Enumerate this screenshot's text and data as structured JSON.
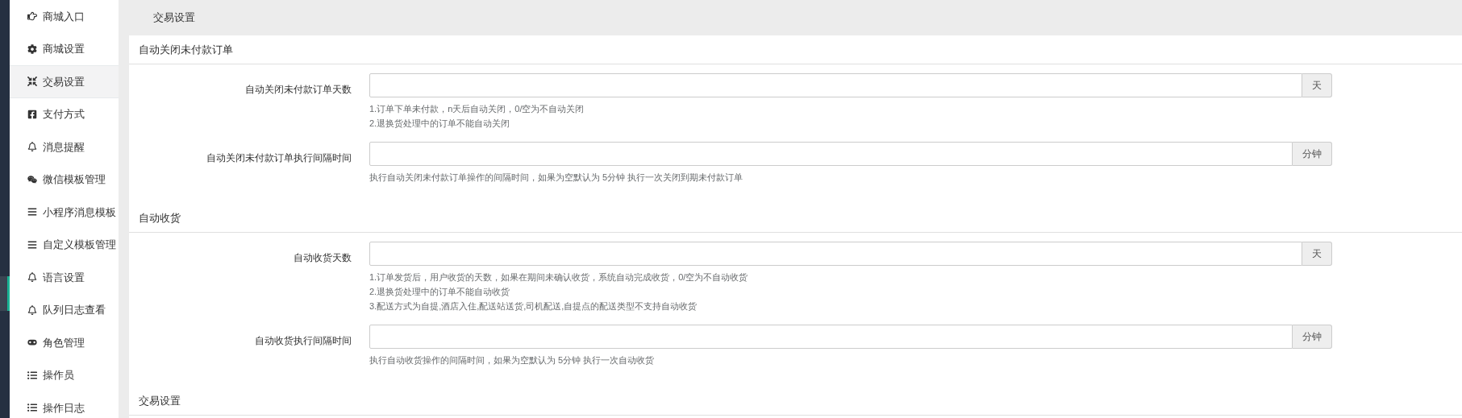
{
  "sidebar": {
    "items": [
      {
        "label": "商城入口",
        "selected": false
      },
      {
        "label": "商城设置",
        "selected": false
      },
      {
        "label": "交易设置",
        "selected": true
      },
      {
        "label": "支付方式",
        "selected": false
      },
      {
        "label": "消息提醒",
        "selected": false
      },
      {
        "label": "微信模板管理",
        "selected": false
      },
      {
        "label": "小程序消息模板",
        "selected": false
      },
      {
        "label": "自定义模板管理",
        "selected": false
      },
      {
        "label": "语言设置",
        "selected": false
      },
      {
        "label": "队列日志查看",
        "selected": false
      },
      {
        "label": "角色管理",
        "selected": false
      },
      {
        "label": "操作员",
        "selected": false
      },
      {
        "label": "操作日志",
        "selected": false
      }
    ]
  },
  "page_title": "交易设置",
  "sections": [
    {
      "title": "自动关闭未付款订单",
      "fields": [
        {
          "label": "自动关闭未付款订单天数",
          "addon": "天",
          "help": [
            "1.订单下单未付款，n天后自动关闭，0/空为不自动关闭",
            "2.退换货处理中的订单不能自动关闭"
          ]
        },
        {
          "label": "自动关闭未付款订单执行间隔时间",
          "addon": "分钟",
          "help": [
            "执行自动关闭未付款订单操作的间隔时间，如果为空默认为 5分钟 执行一次关闭到期未付款订单"
          ]
        }
      ]
    },
    {
      "title": "自动收货",
      "fields": [
        {
          "label": "自动收货天数",
          "addon": "天",
          "help": [
            "1.订单发货后，用户收货的天数，如果在期间未确认收货，系统自动完成收货，0/空为不自动收货",
            "2.退换货处理中的订单不能自动收货",
            "3.配送方式为自提,酒店入住,配送站送货,司机配送,自提点的配送类型不支持自动收货"
          ]
        },
        {
          "label": "自动收货执行间隔时间",
          "addon": "分钟",
          "help": [
            "执行自动收货操作的间隔时间，如果为空默认为 5分钟 执行一次自动收货"
          ]
        }
      ]
    },
    {
      "title": "交易设置"
    }
  ]
}
